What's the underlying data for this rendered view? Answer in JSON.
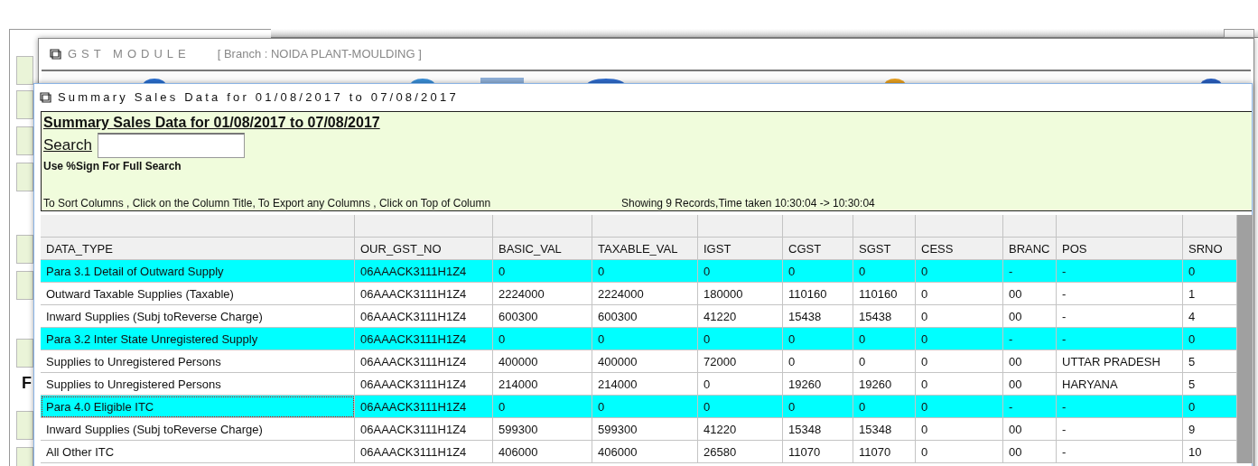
{
  "background_window": {
    "side_letter": "F"
  },
  "gst_window": {
    "title": "GST MODULE",
    "branch": "[ Branch : NOIDA PLANT-MOULDING ]"
  },
  "summary_window": {
    "title": "Summary Sales Data for 01/08/2017 to 07/08/2017"
  },
  "panel": {
    "heading": "Summary Sales Data for 01/08/2017 to 07/08/2017",
    "search_label": "Search",
    "hint": "Use %Sign For Full Search",
    "sort_hint": "To Sort Columns , Click on the Column Title, To Export any Columns , Click on Top of Column",
    "records_info": "Showing 9 Records,Time taken 10:30:04 -> 10:30:04"
  },
  "table": {
    "columns": [
      "DATA_TYPE",
      "OUR_GST_NO",
      "BASIC_VAL",
      "TAXABLE_VAL",
      "IGST",
      "CGST",
      "SGST",
      "CESS",
      "BRANC",
      "POS",
      "SRNO"
    ],
    "rows": [
      {
        "kind": "section",
        "focused": false,
        "cells": [
          "Para 3.1 Detail of Outward Supply",
          "06AAACK3111H1Z4",
          "0",
          "0",
          "0",
          "0",
          "0",
          "0",
          "-",
          "-",
          "0"
        ]
      },
      {
        "kind": "item",
        "focused": false,
        "cells": [
          "Outward Taxable Supplies (Taxable)",
          "06AAACK3111H1Z4",
          "2224000",
          "2224000",
          "180000",
          "110160",
          "110160",
          "0",
          "00",
          "-",
          "1"
        ]
      },
      {
        "kind": "item",
        "focused": false,
        "cells": [
          "Inward Supplies (Subj toReverse Charge)",
          "06AAACK3111H1Z4",
          "600300",
          "600300",
          "41220",
          "15438",
          "15438",
          "0",
          "00",
          "-",
          "4"
        ]
      },
      {
        "kind": "section",
        "focused": false,
        "cells": [
          "Para 3.2 Inter State Unregistered Supply",
          "06AAACK3111H1Z4",
          "0",
          "0",
          "0",
          "0",
          "0",
          "0",
          "-",
          "-",
          "0"
        ]
      },
      {
        "kind": "item",
        "focused": false,
        "cells": [
          "Supplies to Unregistered Persons",
          "06AAACK3111H1Z4",
          "400000",
          "400000",
          "72000",
          "0",
          "0",
          "0",
          "00",
          "UTTAR PRADESH",
          "5"
        ]
      },
      {
        "kind": "item",
        "focused": false,
        "cells": [
          "Supplies to Unregistered Persons",
          "06AAACK3111H1Z4",
          "214000",
          "214000",
          "0",
          "19260",
          "19260",
          "0",
          "00",
          "HARYANA",
          "5"
        ]
      },
      {
        "kind": "section",
        "focused": true,
        "cells": [
          "Para 4.0 Eligible ITC",
          "06AAACK3111H1Z4",
          "0",
          "0",
          "0",
          "0",
          "0",
          "0",
          "-",
          "-",
          "0"
        ]
      },
      {
        "kind": "item",
        "focused": false,
        "cells": [
          "Inward Supplies (Subj toReverse Charge)",
          "06AAACK3111H1Z4",
          "599300",
          "599300",
          "41220",
          "15348",
          "15348",
          "0",
          "00",
          "-",
          "9"
        ]
      },
      {
        "kind": "item",
        "focused": false,
        "cells": [
          "All Other ITC",
          "06AAACK3111H1Z4",
          "406000",
          "406000",
          "26580",
          "11070",
          "11070",
          "0",
          "00",
          "-",
          "10"
        ]
      }
    ]
  }
}
